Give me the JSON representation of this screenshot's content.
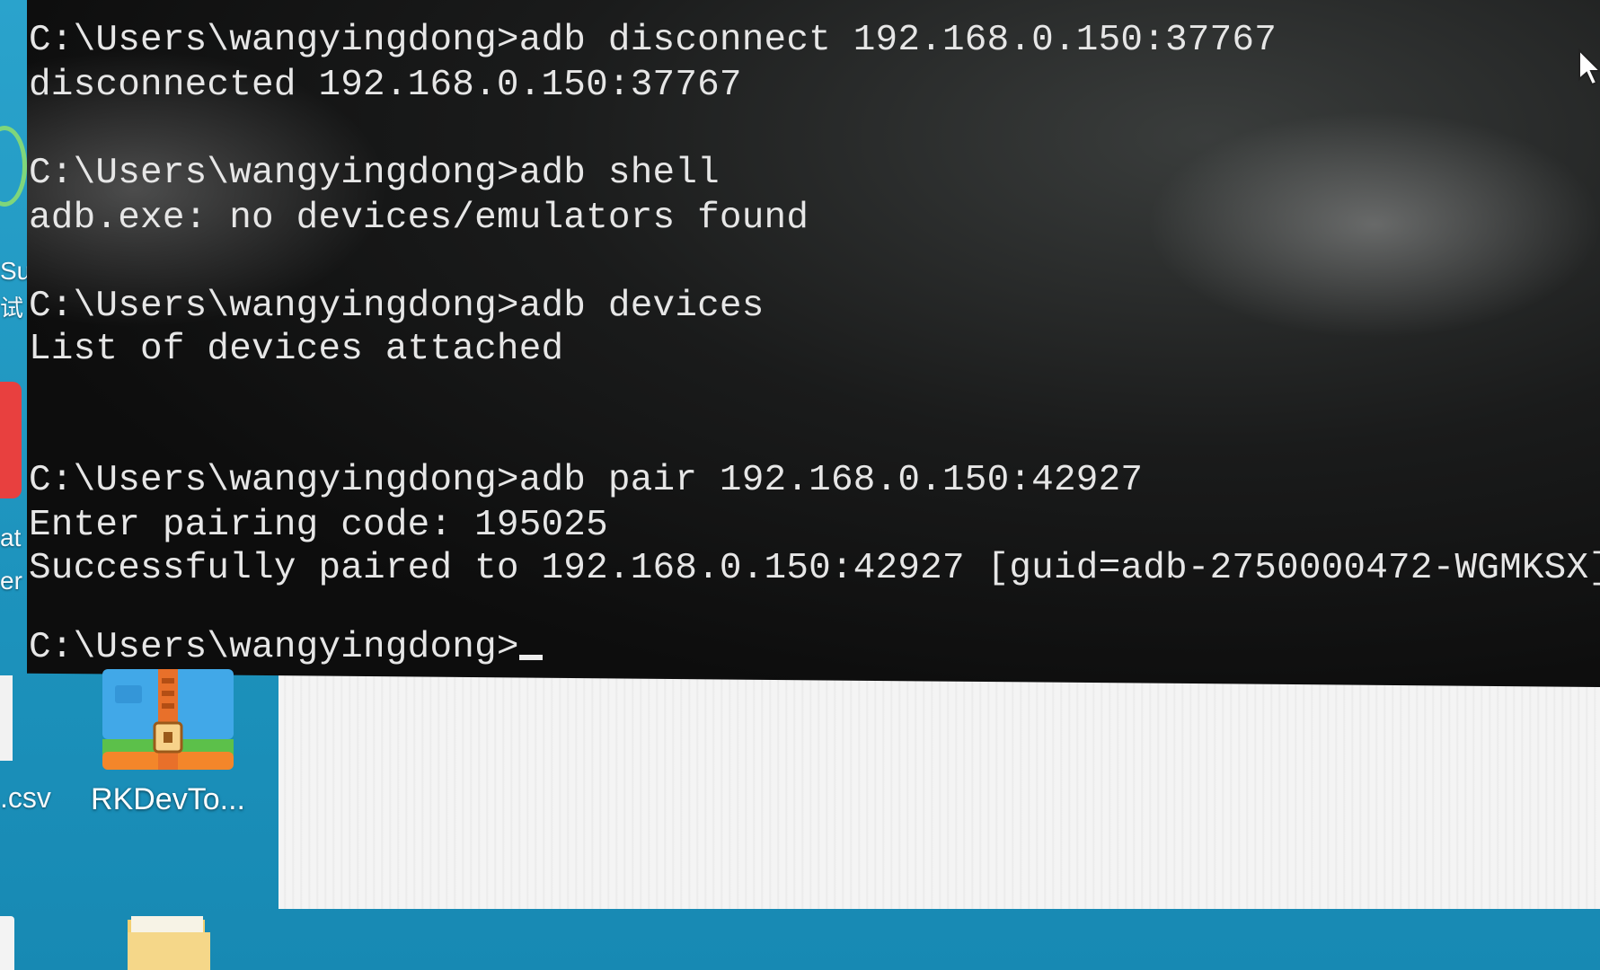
{
  "terminal": {
    "lines": [
      "C:\\Users\\wangyingdong>adb disconnect 192.168.0.150:37767",
      "disconnected 192.168.0.150:37767",
      "",
      "C:\\Users\\wangyingdong>adb shell",
      "adb.exe: no devices/emulators found",
      "",
      "C:\\Users\\wangyingdong>adb devices",
      "List of devices attached",
      "",
      "",
      "C:\\Users\\wangyingdong>adb pair 192.168.0.150:42927",
      "Enter pairing code: 195025",
      "Successfully paired to 192.168.0.150:42927 [guid=adb-2750000472-WGMKSX]",
      "",
      "C:\\Users\\wangyingdong>"
    ]
  },
  "desktop": {
    "icons": [
      {
        "label": "RKDevTo...",
        "icon": "rkdevtool-archive-icon"
      },
      {
        "label": "",
        "icon": "folder-icon"
      }
    ],
    "left_fragments": {
      "su": "Su",
      "shi": "试",
      "at": "at",
      "er": "er",
      "csv": ".csv"
    }
  },
  "colors": {
    "desktop_background": "#1f9bc4",
    "terminal_background": "#0d0d0d",
    "terminal_text": "#e6e6e6"
  }
}
